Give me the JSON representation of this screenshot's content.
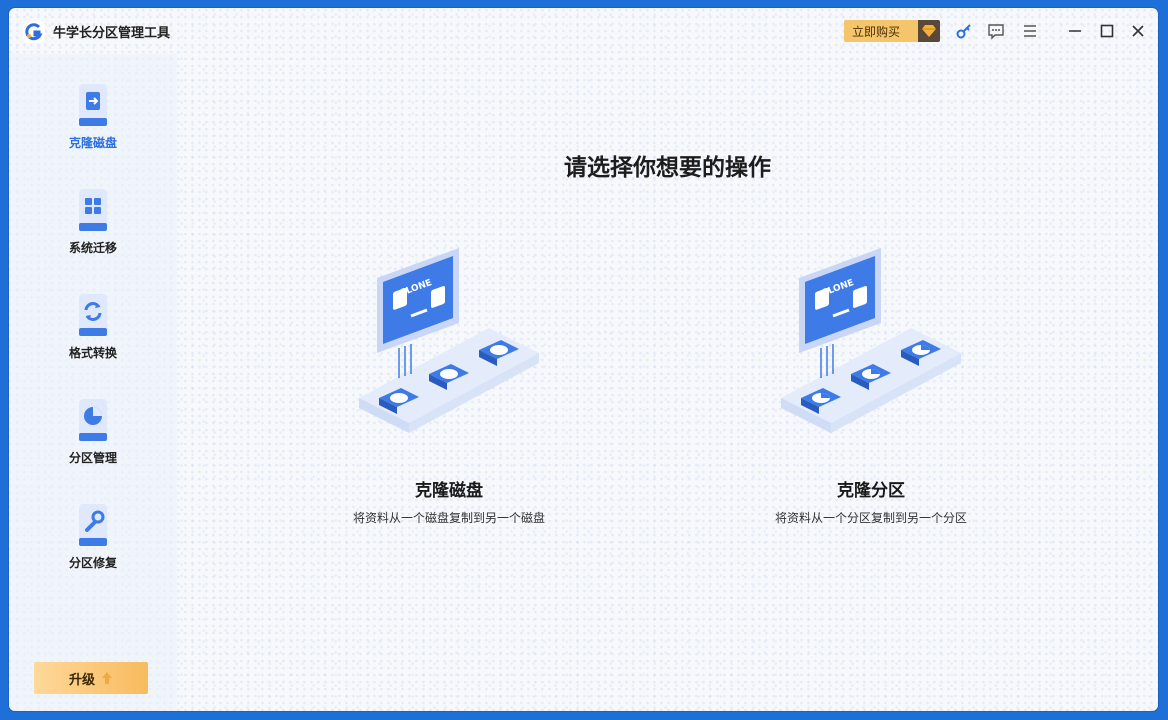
{
  "app": {
    "title": "牛学长分区管理工具"
  },
  "titlebar": {
    "buy_label": "立即购买",
    "icons": [
      "key-icon",
      "feedback-icon",
      "menu-icon",
      "minimize-icon",
      "maximize-icon",
      "close-icon"
    ]
  },
  "sidebar": {
    "items": [
      {
        "label": "克隆磁盘",
        "icon": "clone-disk-icon",
        "active": true
      },
      {
        "label": "系统迁移",
        "icon": "system-migrate-icon",
        "active": false
      },
      {
        "label": "格式转换",
        "icon": "format-convert-icon",
        "active": false
      },
      {
        "label": "分区管理",
        "icon": "partition-manage-icon",
        "active": false
      },
      {
        "label": "分区修复",
        "icon": "partition-repair-icon",
        "active": false
      }
    ],
    "upgrade_label": "升级"
  },
  "main": {
    "heading": "请选择你想要的操作",
    "cards": [
      {
        "title": "克隆磁盘",
        "desc": "将资料从一个磁盘复制到另一个磁盘",
        "illus_text": "CLONE"
      },
      {
        "title": "克隆分区",
        "desc": "将资料从一个分区复制到另一个分区",
        "illus_text": "CLONE"
      }
    ]
  },
  "colors": {
    "accent": "#2b6fe0",
    "buy": "#f5c56b",
    "frame": "#1f6fd8"
  }
}
